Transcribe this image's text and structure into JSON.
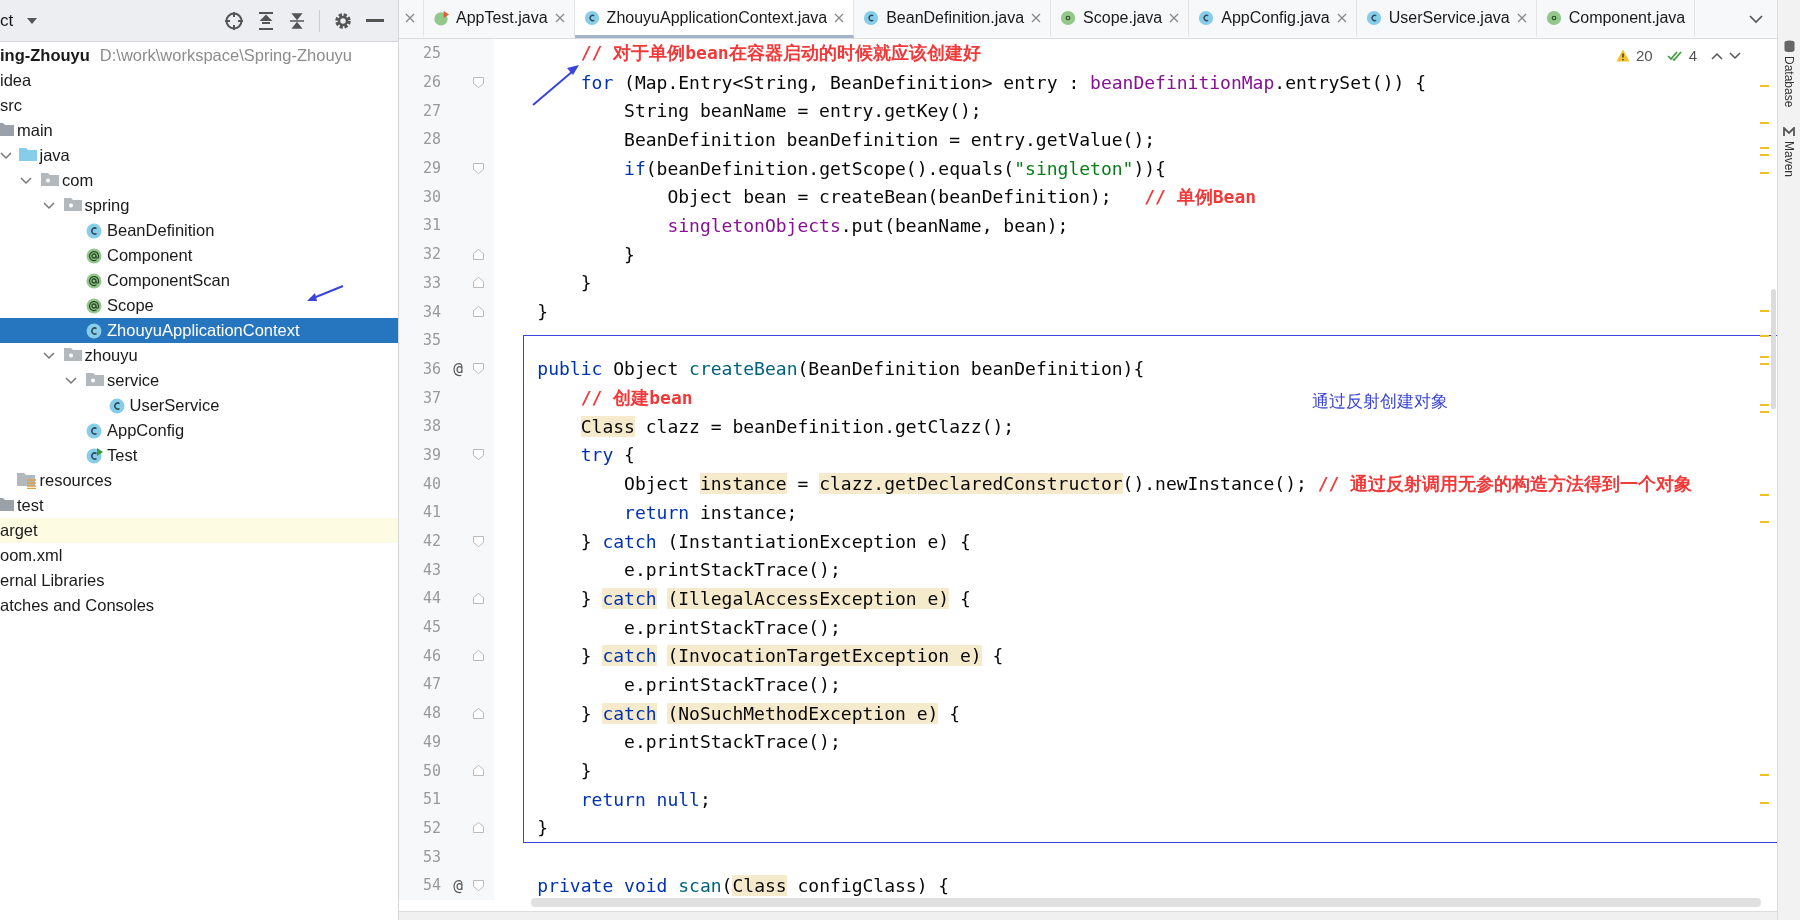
{
  "project_panel": {
    "title": "ct"
  },
  "project_tree": {
    "items": [
      {
        "label": "ing-Zhouyu",
        "path": "D:\\work\\workspace\\Spring-Zhouyu",
        "kind": "module",
        "selected": false,
        "excluded": false,
        "children": [
          {
            "label": "idea",
            "selected": false,
            "excluded": false
          },
          {
            "label": "src",
            "selected": false,
            "excluded": false,
            "children": [
              {
                "label": "main",
                "kind": "folder",
                "selected": false,
                "excluded": false,
                "children": [
                  {
                    "label": "java",
                    "kind": "source",
                    "expanded": true,
                    "selected": false,
                    "excluded": false,
                    "children": [
                      {
                        "label": "com",
                        "kind": "package",
                        "expanded": true,
                        "selected": false,
                        "excluded": false,
                        "children": [
                          {
                            "label": "spring",
                            "kind": "package",
                            "expanded": true,
                            "selected": false,
                            "excluded": false,
                            "children": [
                              {
                                "label": "BeanDefinition",
                                "kind": "class",
                                "selected": false,
                                "excluded": false
                              },
                              {
                                "label": "Component",
                                "kind": "annotation",
                                "selected": false,
                                "excluded": false
                              },
                              {
                                "label": "ComponentScan",
                                "kind": "annotation",
                                "selected": false,
                                "excluded": false
                              },
                              {
                                "label": "Scope",
                                "kind": "annotation",
                                "selected": false,
                                "excluded": false
                              },
                              {
                                "label": "ZhouyuApplicationContext",
                                "kind": "class",
                                "selected": true,
                                "excluded": false
                              }
                            ]
                          },
                          {
                            "label": "zhouyu",
                            "kind": "package",
                            "expanded": true,
                            "selected": false,
                            "excluded": false,
                            "children": [
                              {
                                "label": "service",
                                "kind": "package",
                                "expanded": true,
                                "selected": false,
                                "excluded": false,
                                "children": [
                                  {
                                    "label": "UserService",
                                    "kind": "class",
                                    "selected": false,
                                    "excluded": false
                                  }
                                ]
                              },
                              {
                                "label": "AppConfig",
                                "kind": "class",
                                "selected": false,
                                "excluded": false
                              },
                              {
                                "label": "Test",
                                "kind": "runnable",
                                "selected": false,
                                "excluded": false
                              }
                            ]
                          }
                        ]
                      }
                    ]
                  },
                  {
                    "label": "resources",
                    "kind": "resources",
                    "selected": false,
                    "excluded": false
                  }
                ]
              },
              {
                "label": "test",
                "kind": "folder",
                "selected": false,
                "excluded": false
              }
            ]
          },
          {
            "label": "arget",
            "selected": false,
            "excluded": true
          },
          {
            "label": "oom.xml",
            "selected": false,
            "excluded": false
          }
        ]
      },
      {
        "label": "ernal Libraries",
        "selected": false,
        "excluded": false
      },
      {
        "label": "atches and Consoles",
        "selected": false,
        "excluded": false
      }
    ]
  },
  "tabs": [
    {
      "label": "AppTest.java",
      "kind": "test",
      "selected": false
    },
    {
      "label": "ZhouyuApplicationContext.java",
      "kind": "class",
      "selected": true
    },
    {
      "label": "BeanDefinition.java",
      "kind": "class",
      "selected": false
    },
    {
      "label": "Scope.java",
      "kind": "annotation",
      "selected": false
    },
    {
      "label": "AppConfig.java",
      "kind": "class",
      "selected": false
    },
    {
      "label": "UserService.java",
      "kind": "class",
      "selected": false
    },
    {
      "label": "Component.java",
      "kind": "annotation",
      "selected": false
    }
  ],
  "inspection": {
    "warnings": "20",
    "checks": "4"
  },
  "code": {
    "lines": [
      {
        "number": "25",
        "kind": "plain",
        "segments": [
          {
            "kind": "comment",
            "text": "        // 对于单例bean在容器启动的时候就应该创建好"
          }
        ]
      },
      {
        "number": "26",
        "kind": "fold-start",
        "segments": [
          {
            "kind": "kw",
            "text": "        for"
          },
          {
            "kind": "plain",
            "text": " (Map.Entry<String, BeanDefinition> entry : "
          },
          {
            "kind": "field",
            "text": "beanDefinitionMap"
          },
          {
            "kind": "plain",
            "text": ".entrySet()) {"
          }
        ]
      },
      {
        "number": "27",
        "kind": "plain",
        "segments": [
          {
            "kind": "plain",
            "text": "            String beanName = entry.getKey();"
          }
        ]
      },
      {
        "number": "28",
        "kind": "plain",
        "segments": [
          {
            "kind": "plain",
            "text": "            BeanDefinition beanDefinition = entry.getValue();"
          }
        ]
      },
      {
        "number": "29",
        "kind": "fold-start",
        "segments": [
          {
            "kind": "kw",
            "text": "            if"
          },
          {
            "kind": "plain",
            "text": "(beanDefinition.getScope().equals("
          },
          {
            "kind": "string",
            "text": "\"singleton\""
          },
          {
            "kind": "plain",
            "text": ")){"
          }
        ]
      },
      {
        "number": "30",
        "kind": "plain",
        "segments": [
          {
            "kind": "plain",
            "text": "                Object bean = createBean(beanDefinition);   "
          },
          {
            "kind": "comment",
            "text": "// 单例Bean"
          }
        ]
      },
      {
        "number": "31",
        "kind": "plain",
        "segments": [
          {
            "kind": "field",
            "text": "                singletonObjects"
          },
          {
            "kind": "plain",
            "text": ".put(beanName, bean);"
          }
        ]
      },
      {
        "number": "32",
        "kind": "fold-end",
        "segments": [
          {
            "kind": "plain",
            "text": "            }"
          }
        ]
      },
      {
        "number": "33",
        "kind": "fold-end",
        "segments": [
          {
            "kind": "plain",
            "text": "        }"
          }
        ]
      },
      {
        "number": "34",
        "kind": "fold-end",
        "segments": [
          {
            "kind": "plain",
            "text": "    }"
          }
        ]
      },
      {
        "number": "35",
        "kind": "plain"
      },
      {
        "number": "36",
        "marker": "@",
        "kind": "fold-start",
        "segments": [
          {
            "kind": "kw",
            "text": "    public"
          },
          {
            "kind": "plain",
            "text": " Object "
          },
          {
            "kind": "method",
            "text": "createBean"
          },
          {
            "kind": "plain",
            "text": "(BeanDefinition beanDefinition){"
          }
        ]
      },
      {
        "number": "37",
        "kind": "plain",
        "segments": [
          {
            "kind": "comment",
            "text": "        // 创建bean"
          }
        ]
      },
      {
        "number": "38",
        "kind": "plain",
        "segments": [
          {
            "kind": "hl",
            "text": "        Class"
          },
          {
            "kind": "plain",
            "text": " clazz = beanDefinition.getClazz();"
          }
        ]
      },
      {
        "number": "39",
        "kind": "fold-start",
        "segments": [
          {
            "kind": "kw",
            "text": "        try"
          },
          {
            "kind": "plain",
            "text": " {"
          }
        ]
      },
      {
        "number": "40",
        "kind": "plain",
        "segments": [
          {
            "kind": "plain",
            "text": "            Object "
          },
          {
            "kind": "hl",
            "text": "instance"
          },
          {
            "kind": "plain",
            "text": " = "
          },
          {
            "kind": "hl",
            "text": "clazz.getDeclaredConstructor"
          },
          {
            "kind": "plain",
            "text": "().newInstance(); "
          },
          {
            "kind": "comment",
            "text": "// 通过反射调用无参的构造方法得到一个对象"
          }
        ]
      },
      {
        "number": "41",
        "kind": "plain",
        "segments": [
          {
            "kind": "kw",
            "text": "            return"
          },
          {
            "kind": "plain",
            "text": " instance;"
          }
        ]
      },
      {
        "number": "42",
        "kind": "fold-start",
        "segments": [
          {
            "kind": "plain",
            "text": "        } "
          },
          {
            "kind": "kw",
            "text": "catch"
          },
          {
            "kind": "plain",
            "text": " (InstantiationException e) {"
          }
        ]
      },
      {
        "number": "43",
        "kind": "plain",
        "segments": [
          {
            "kind": "plain",
            "text": "            e.printStackTrace();"
          }
        ]
      },
      {
        "number": "44",
        "kind": "fold-end",
        "segments": [
          {
            "kind": "plain",
            "text": "        } "
          },
          {
            "kind": "hlkw",
            "text": "catch"
          },
          {
            "kind": "hl",
            "text": " (IllegalAccessException e)"
          },
          {
            "kind": "plain",
            "text": " {"
          }
        ]
      },
      {
        "number": "45",
        "kind": "plain",
        "segments": [
          {
            "kind": "plain",
            "text": "            e.printStackTrace();"
          }
        ]
      },
      {
        "number": "46",
        "kind": "fold-end",
        "segments": [
          {
            "kind": "plain",
            "text": "        } "
          },
          {
            "kind": "hlkw",
            "text": "catch"
          },
          {
            "kind": "hl",
            "text": " (InvocationTargetException e)"
          },
          {
            "kind": "plain",
            "text": " {"
          }
        ]
      },
      {
        "number": "47",
        "kind": "plain",
        "segments": [
          {
            "kind": "plain",
            "text": "            e.printStackTrace();"
          }
        ]
      },
      {
        "number": "48",
        "kind": "fold-end",
        "segments": [
          {
            "kind": "plain",
            "text": "        } "
          },
          {
            "kind": "hlkw",
            "text": "catch"
          },
          {
            "kind": "hl",
            "text": " (NoSuchMethodException e)"
          },
          {
            "kind": "plain",
            "text": " {"
          }
        ]
      },
      {
        "number": "49",
        "kind": "plain",
        "segments": [
          {
            "kind": "plain",
            "text": "            e.printStackTrace();"
          }
        ]
      },
      {
        "number": "50",
        "kind": "fold-end",
        "segments": [
          {
            "kind": "plain",
            "text": "        }"
          }
        ]
      },
      {
        "number": "51",
        "kind": "plain",
        "segments": [
          {
            "kind": "kw",
            "text": "        return null"
          },
          {
            "kind": "plain",
            "text": ";"
          }
        ]
      },
      {
        "number": "52",
        "kind": "fold-end",
        "segments": [
          {
            "kind": "plain",
            "text": "    }"
          }
        ]
      },
      {
        "number": "53",
        "kind": "plain"
      },
      {
        "number": "54",
        "marker": "@",
        "kind": "fold-start",
        "segments": [
          {
            "kind": "kw",
            "text": "    private void"
          },
          {
            "kind": "method",
            "text": " scan"
          },
          {
            "kind": "plain",
            "text": "("
          },
          {
            "kind": "hl",
            "text": "Class"
          },
          {
            "kind": "plain",
            "text": " configClass) {"
          }
        ]
      }
    ]
  },
  "annotation": {
    "note": "通过反射创建对象"
  },
  "tool_strip": [
    "Database",
    "Maven"
  ]
}
